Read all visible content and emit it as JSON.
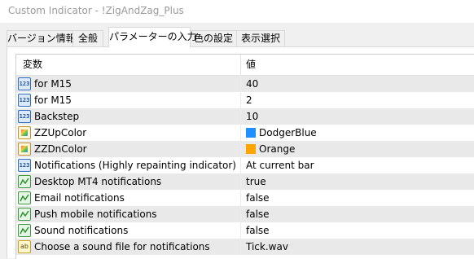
{
  "window": {
    "title": "Custom Indicator - !ZigAndZag_Plus"
  },
  "tabs": [
    {
      "label": "バージョン情報"
    },
    {
      "label": "全般"
    },
    {
      "label": "パラメーターの入力"
    },
    {
      "label": "色の設定"
    },
    {
      "label": "表示選択"
    }
  ],
  "grid": {
    "header_name": "変数",
    "header_value": "値",
    "rows": [
      {
        "name": "for  M15",
        "value": "40",
        "icon": "int-icon"
      },
      {
        "name": "for M15",
        "value": "2",
        "icon": "int-icon"
      },
      {
        "name": "Backstep",
        "value": "10",
        "icon": "int-icon"
      },
      {
        "name": "ZZUpColor",
        "value": "DodgerBlue",
        "icon": "color-icon",
        "swatch": "#1e90ff"
      },
      {
        "name": "ZZDnColor",
        "value": "Orange",
        "icon": "color-icon",
        "swatch": "#ffa500"
      },
      {
        "name": "Notifications (Highly repainting indicator)",
        "value": "At current bar",
        "icon": "int-icon"
      },
      {
        "name": "Desktop MT4 notifications",
        "value": "true",
        "icon": "bool-icon"
      },
      {
        "name": "Email notifications",
        "value": "false",
        "icon": "bool-icon"
      },
      {
        "name": "Push mobile notifications",
        "value": "false",
        "icon": "bool-icon"
      },
      {
        "name": "Sound notifications",
        "value": "false",
        "icon": "bool-icon"
      },
      {
        "name": "Choose a sound file for notifications",
        "value": "Tick.wav",
        "icon": "string-icon"
      }
    ]
  },
  "colors": {
    "alt_row": "#e9e9e9",
    "dodger_blue": "#1e90ff",
    "orange": "#ffa500"
  }
}
